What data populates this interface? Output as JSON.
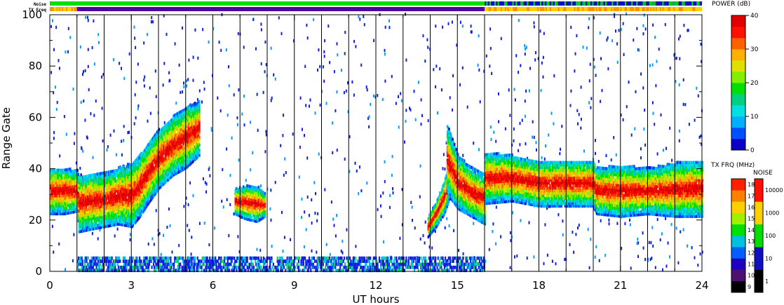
{
  "chart_data": {
    "type": "heatmap",
    "title": "",
    "xlabel": "UT hours",
    "ylabel": "Range Gate",
    "xlim": [
      0,
      24
    ],
    "ylim": [
      0,
      100
    ],
    "x_ticks": [
      "0",
      "3",
      "6",
      "9",
      "12",
      "15",
      "18",
      "21",
      "24"
    ],
    "y_ticks": [
      "0",
      "20",
      "40",
      "60",
      "80",
      "100"
    ],
    "strip_labels": {
      "noise": "Noise",
      "tx_freq": "TX Freq"
    },
    "power_colorbar": {
      "label": "POWER (dB)",
      "range": [
        0,
        40
      ],
      "ticks": [
        "0",
        "10",
        "20",
        "30",
        "40"
      ],
      "colors": [
        "#0a00c8",
        "#0050ff",
        "#00b0ff",
        "#00e0e0",
        "#00d080",
        "#00e000",
        "#80f000",
        "#e0e000",
        "#ffb000",
        "#ff6000",
        "#ff1000",
        "#e00000"
      ]
    },
    "txfreq_colorbar": {
      "label": "TX FRQ (MHz)",
      "ticks": [
        "9",
        "10",
        "11",
        "12",
        "13",
        "14",
        "15",
        "16",
        "17",
        "18"
      ],
      "colors": [
        "#000000",
        "#501070",
        "#2000c0",
        "#0060ff",
        "#00c0e0",
        "#00e000",
        "#a0f000",
        "#ffd000",
        "#ff8000",
        "#ff2000"
      ]
    },
    "noise_colorbar": {
      "label": "NOISE",
      "ticks": [
        "1",
        "10",
        "100",
        "1000",
        "10000"
      ],
      "colors": [
        "#000000",
        "#1010c0",
        "#00e000",
        "#ffd000",
        "#ff1000"
      ]
    },
    "bands": [
      {
        "t": [
          0.0,
          0.5,
          1.0,
          1.05,
          1.5,
          2.0,
          2.5,
          3.0,
          3.3,
          3.6,
          4.0,
          4.5,
          5.0,
          5.5
        ],
        "lo": [
          22,
          22,
          23,
          15,
          16,
          17,
          18,
          17,
          21,
          26,
          32,
          37,
          40,
          45
        ],
        "hi": [
          40,
          40,
          39,
          37,
          38,
          38,
          40,
          42,
          45,
          50,
          55,
          60,
          64,
          66
        ]
      },
      {
        "t": [
          6.8,
          7.2,
          7.6,
          7.9
        ],
        "lo": [
          22,
          20,
          19,
          21
        ],
        "hi": [
          32,
          33,
          33,
          30
        ]
      },
      {
        "t": [
          13.9,
          14.2,
          14.5,
          14.7
        ],
        "lo": [
          13,
          17,
          22,
          28
        ],
        "hi": [
          21,
          27,
          35,
          42
        ]
      },
      {
        "t": [
          14.6,
          15.0,
          15.5,
          16.0
        ],
        "lo": [
          30,
          24,
          21,
          18
        ],
        "hi": [
          57,
          45,
          40,
          38
        ]
      },
      {
        "t": [
          16.0,
          17.0,
          18.0,
          19.0,
          20.0,
          20.1,
          21.0,
          22.0,
          23.0,
          24.0
        ],
        "lo": [
          26,
          27,
          25,
          25,
          25,
          22,
          21,
          22,
          21,
          21
        ],
        "hi": [
          46,
          45,
          43,
          43,
          43,
          40,
          41,
          40,
          42,
          43
        ]
      }
    ],
    "series": [
      {
        "name": "Noise",
        "segments": [
          {
            "start": 0,
            "end": 16,
            "level": "100"
          },
          {
            "start": 16,
            "end": 24,
            "level": "10-100"
          }
        ]
      },
      {
        "name": "TX Freq",
        "segments": [
          {
            "start": 0,
            "end": 1,
            "level": "15-16"
          },
          {
            "start": 1,
            "end": 16,
            "level": "11"
          },
          {
            "start": 16,
            "end": 24,
            "level": "15-16"
          }
        ]
      }
    ],
    "grid": true,
    "legend_position": "right"
  },
  "colors": {
    "frame": "#000000",
    "background": "#ffffff"
  }
}
